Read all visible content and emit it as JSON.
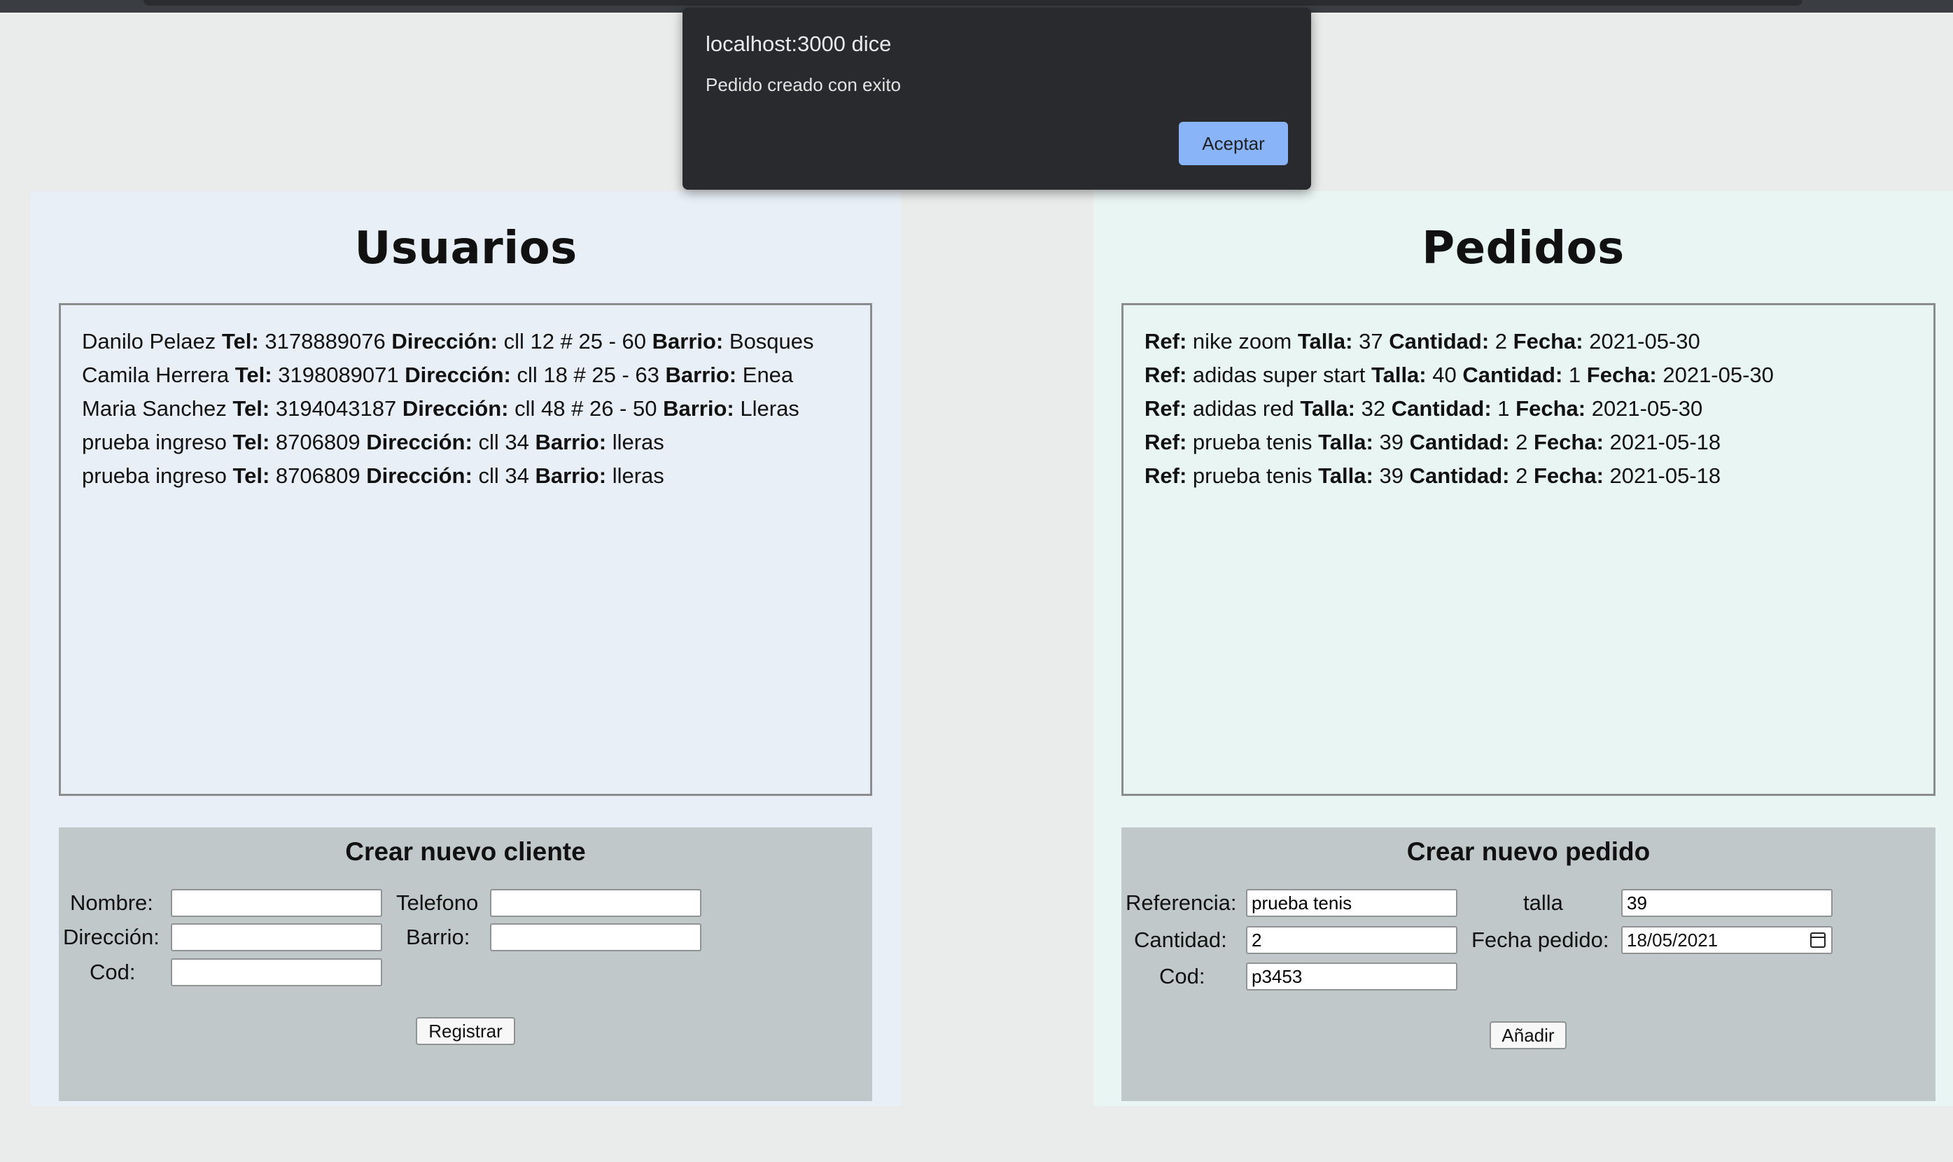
{
  "dialog": {
    "title": "localhost:3000 dice",
    "message": "Pedido creado con exito",
    "ok_label": "Aceptar"
  },
  "users": {
    "title": "Usuarios",
    "list": [
      {
        "name": "Danilo Pelaez",
        "tel_label": "Tel:",
        "tel": "3178889076",
        "dir_label": "Dirección:",
        "dir": "cll 12 # 25 - 60",
        "barrio_label": "Barrio:",
        "barrio": "Bosques"
      },
      {
        "name": "Camila Herrera",
        "tel_label": "Tel:",
        "tel": "3198089071",
        "dir_label": "Dirección:",
        "dir": "cll 18 # 25 - 63",
        "barrio_label": "Barrio:",
        "barrio": "Enea"
      },
      {
        "name": "Maria Sanchez",
        "tel_label": "Tel:",
        "tel": "3194043187",
        "dir_label": "Dirección:",
        "dir": "cll 48 # 26 - 50",
        "barrio_label": "Barrio:",
        "barrio": "Lleras"
      },
      {
        "name": "prueba ingreso",
        "tel_label": "Tel:",
        "tel": "8706809",
        "dir_label": "Dirección:",
        "dir": "cll 34",
        "barrio_label": "Barrio:",
        "barrio": "lleras"
      },
      {
        "name": "prueba ingreso",
        "tel_label": "Tel:",
        "tel": "8706809",
        "dir_label": "Dirección:",
        "dir": "cll 34",
        "barrio_label": "Barrio:",
        "barrio": "lleras"
      }
    ],
    "form": {
      "title": "Crear nuevo cliente",
      "nombre_label": "Nombre:",
      "telefono_label": "Telefono",
      "direccion_label": "Dirección:",
      "barrio_label": "Barrio:",
      "cod_label": "Cod:",
      "nombre_value": "",
      "telefono_value": "",
      "direccion_value": "",
      "barrio_value": "",
      "cod_value": "",
      "submit_label": "Registrar"
    }
  },
  "orders": {
    "title": "Pedidos",
    "list": [
      {
        "ref_label": "Ref:",
        "ref": "nike zoom",
        "talla_label": "Talla:",
        "talla": "37",
        "cant_label": "Cantidad:",
        "cant": "2",
        "fecha_label": "Fecha:",
        "fecha": "2021-05-30"
      },
      {
        "ref_label": "Ref:",
        "ref": "adidas super start",
        "talla_label": "Talla:",
        "talla": "40",
        "cant_label": "Cantidad:",
        "cant": "1",
        "fecha_label": "Fecha:",
        "fecha": "2021-05-30"
      },
      {
        "ref_label": "Ref:",
        "ref": "adidas red",
        "talla_label": "Talla:",
        "talla": "32",
        "cant_label": "Cantidad:",
        "cant": "1",
        "fecha_label": "Fecha:",
        "fecha": "2021-05-30"
      },
      {
        "ref_label": "Ref:",
        "ref": "prueba tenis",
        "talla_label": "Talla:",
        "talla": "39",
        "cant_label": "Cantidad:",
        "cant": "2",
        "fecha_label": "Fecha:",
        "fecha": "2021-05-18"
      },
      {
        "ref_label": "Ref:",
        "ref": "prueba tenis",
        "talla_label": "Talla:",
        "talla": "39",
        "cant_label": "Cantidad:",
        "cant": "2",
        "fecha_label": "Fecha:",
        "fecha": "2021-05-18"
      }
    ],
    "form": {
      "title": "Crear nuevo pedido",
      "referencia_label": "Referencia:",
      "talla_label": "talla",
      "cantidad_label": "Cantidad:",
      "fecha_label": "Fecha pedido:",
      "cod_label": "Cod:",
      "referencia_value": "prueba tenis",
      "talla_value": "39",
      "cantidad_value": "2",
      "fecha_value": "18/05/2021",
      "cod_value": "p3453",
      "submit_label": "Añadir",
      "calendar_icon": "calendar-icon"
    }
  }
}
